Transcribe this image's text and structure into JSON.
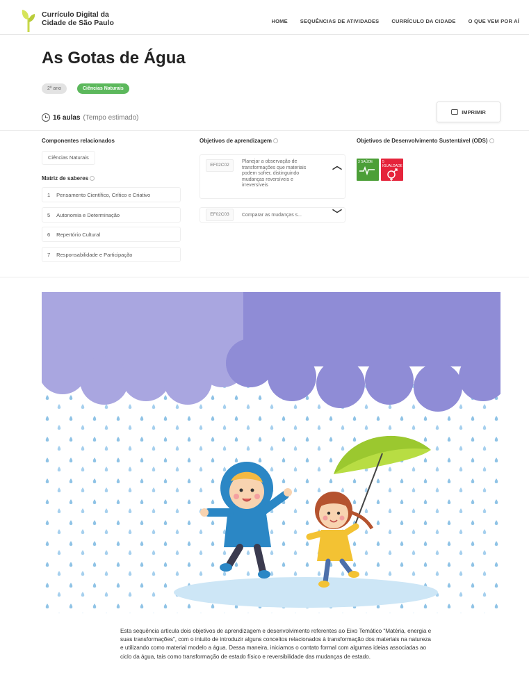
{
  "header": {
    "brand_line1": "Currículo Digital da",
    "brand_line2": "Cidade de São Paulo",
    "nav": [
      "HOME",
      "SEQUÊNCIAS DE ATIVIDADES",
      "CURRÍCULO DA CIDADE",
      "O QUE VEM POR AÍ"
    ]
  },
  "page": {
    "title": "As Gotas de Água",
    "tags": [
      "2º ano",
      "Ciências Naturais"
    ],
    "duration_bold": "16 aulas",
    "duration_rest": "(Tempo estimado)",
    "print_label": "IMPRIMIR"
  },
  "componentes": {
    "heading": "Componentes relacionados",
    "items": [
      "Ciências Naturais"
    ]
  },
  "matriz": {
    "heading": "Matriz de saberes",
    "items": [
      {
        "num": "1",
        "label": "Pensamento Científico, Crítico e Criativo"
      },
      {
        "num": "5",
        "label": "Autonomia e Determinação"
      },
      {
        "num": "6",
        "label": "Repertório Cultural"
      },
      {
        "num": "7",
        "label": "Responsabilidade e Participação"
      }
    ]
  },
  "objetivos": {
    "heading": "Objetivos de aprendizagem",
    "items": [
      {
        "code": "EF02C02",
        "text": "Planejar a observação de transformações que materiais podem sofrer, distinguindo mudanças reversíveis e irreversíveis",
        "expanded": true
      },
      {
        "code": "EF02C03",
        "text": "Comparar as mudanças s...",
        "expanded": false
      }
    ]
  },
  "ods": {
    "heading": "Objetivos de Desenvolvimento Sustentável (ODS)",
    "items": [
      {
        "label": "3 SAÚDE",
        "color": "#4c9f38"
      },
      {
        "label": "5 IGUALDADE",
        "color": "#e5243b"
      }
    ]
  },
  "description": "Esta sequência articula dois objetivos de aprendizagem e desenvolvimento referentes ao Eixo Temático “Matéria, energia e suas transformações”, com o intuito de introduzir alguns conceitos relacionados à transformação dos materiais na natureza e utilizando como material modelo a água. Dessa maneira, iniciamos o contato formal com algumas ideias associadas ao ciclo da água, tais como transformação de estado físico e reversibilidade das mudanças de estado."
}
